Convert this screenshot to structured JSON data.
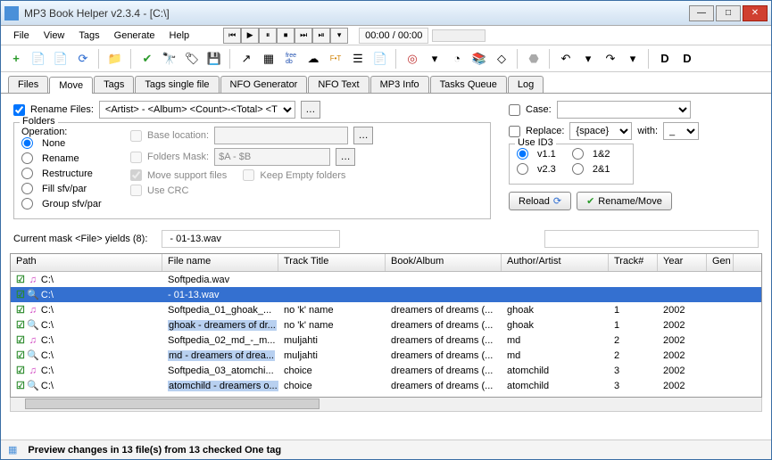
{
  "title": "MP3 Book Helper v2.3.4 - [C:\\]",
  "menu": {
    "file": "File",
    "view": "View",
    "tags": "Tags",
    "generate": "Generate",
    "help": "Help"
  },
  "time": "00:00 / 00:00",
  "tabs": {
    "files": "Files",
    "move": "Move",
    "tags": "Tags",
    "tsingle": "Tags single file",
    "nfogen": "NFO Generator",
    "nfotxt": "NFO Text",
    "mp3info": "MP3 Info",
    "tqueue": "Tasks Queue",
    "log": "Log"
  },
  "rename": {
    "label": "Rename Files:",
    "mask": "<Artist> - <Album> <Count>-<Total> <T"
  },
  "folders": {
    "legend": "Folders",
    "op": "Operation:",
    "none": "None",
    "rename": "Rename",
    "restructure": "Restructure",
    "fill": "Fill sfv/par",
    "group": "Group sfv/par",
    "baseloc": "Base location:",
    "fmask": "Folders Mask:",
    "fmaskval": "$A - $B",
    "movesup": "Move support files",
    "keepempty": "Keep Empty folders",
    "usecrc": "Use CRC"
  },
  "right": {
    "case": "Case:",
    "replace": "Replace:",
    "repval": "{space}",
    "with": "with:",
    "withval": "_",
    "id3": "Use ID3",
    "v11": "v1.1",
    "v12": "1&2",
    "v23": "v2.3",
    "v21": "2&1",
    "reload": "Reload",
    "renmove": "Rename/Move"
  },
  "maskrow": {
    "label": "Current mask <File> yields (8):",
    "value": "- 01-13.wav"
  },
  "cols": {
    "path": "Path",
    "fname": "File name",
    "title": "Track Title",
    "book": "Book/Album",
    "auth": "Author/Artist",
    "track": "Track#",
    "year": "Year",
    "gen": "Gen"
  },
  "rows": [
    {
      "icon": "note",
      "path": "C:\\",
      "fname": "Softpedia.wav",
      "title": "",
      "book": "",
      "auth": "",
      "track": "",
      "year": "",
      "sel": false,
      "hi": false
    },
    {
      "icon": "mag",
      "path": "C:\\",
      "fname": "- 01-13.wav",
      "title": "",
      "book": "",
      "auth": "",
      "track": "",
      "year": "",
      "sel": true,
      "hi": false
    },
    {
      "icon": "note",
      "path": "C:\\",
      "fname": "Softpedia_01_ghoak_...",
      "title": "no 'k' name",
      "book": "dreamers of dreams (...",
      "auth": "ghoak",
      "track": "1",
      "year": "2002",
      "sel": false,
      "hi": false
    },
    {
      "icon": "mag",
      "path": "C:\\",
      "fname": "ghoak - dreamers of dr...",
      "title": "no 'k' name",
      "book": "dreamers of dreams (...",
      "auth": "ghoak",
      "track": "1",
      "year": "2002",
      "sel": false,
      "hi": true
    },
    {
      "icon": "note",
      "path": "C:\\",
      "fname": "Softpedia_02_md_-_m...",
      "title": "muljahti",
      "book": "dreamers of dreams (...",
      "auth": "md",
      "track": "2",
      "year": "2002",
      "sel": false,
      "hi": false
    },
    {
      "icon": "mag",
      "path": "C:\\",
      "fname": "md - dreamers of drea...",
      "title": "muljahti",
      "book": "dreamers of dreams (...",
      "auth": "md",
      "track": "2",
      "year": "2002",
      "sel": false,
      "hi": true
    },
    {
      "icon": "note",
      "path": "C:\\",
      "fname": "Softpedia_03_atomchi...",
      "title": "choice",
      "book": "dreamers of dreams (...",
      "auth": "atomchild",
      "track": "3",
      "year": "2002",
      "sel": false,
      "hi": false
    },
    {
      "icon": "mag",
      "path": "C:\\",
      "fname": "atomchild - dreamers o...",
      "title": "choice",
      "book": "dreamers of dreams (...",
      "auth": "atomchild",
      "track": "3",
      "year": "2002",
      "sel": false,
      "hi": true
    }
  ],
  "status": "Preview changes in 13 file(s) from 13 checked One tag"
}
